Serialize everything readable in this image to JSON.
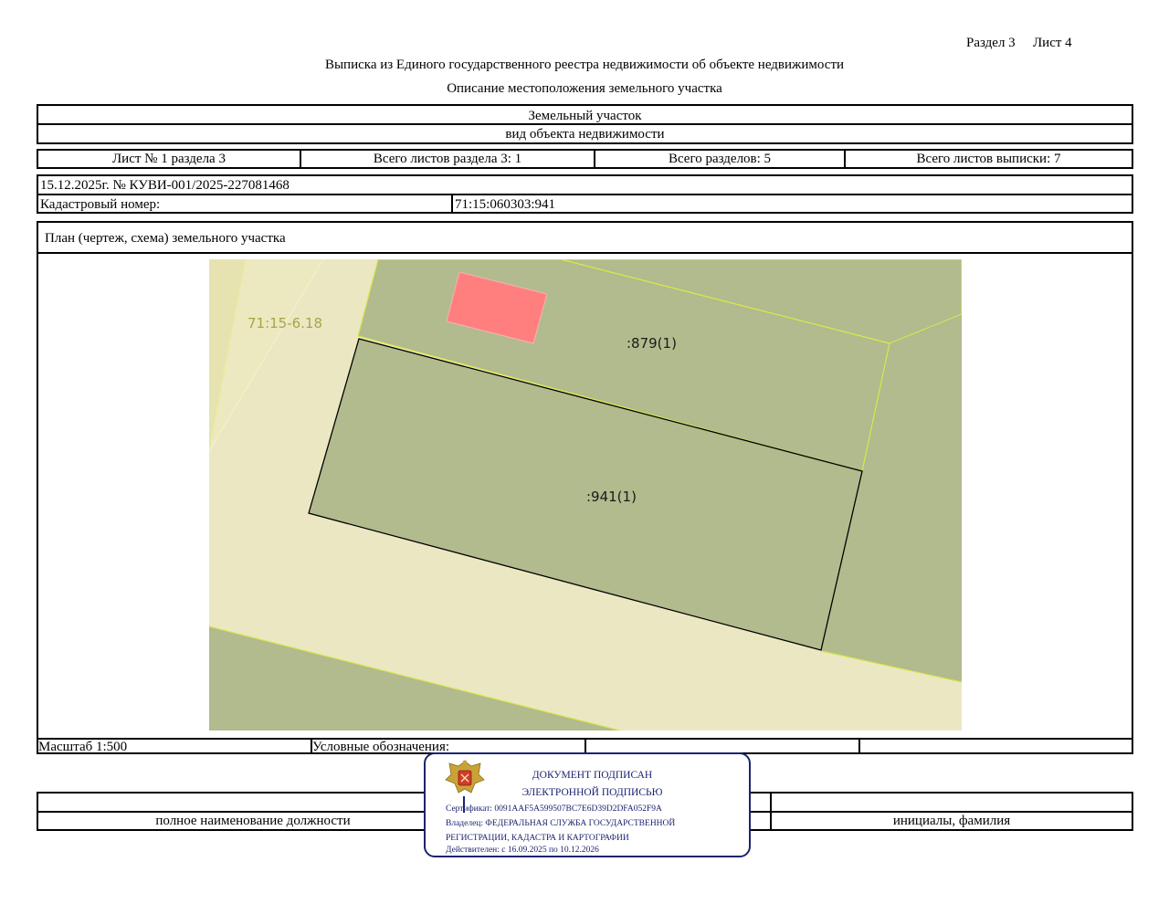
{
  "header": {
    "section_label": "Раздел 3",
    "sheet_label": "Лист 4",
    "title": "Выписка из Единого государственного реестра недвижимости об объекте недвижимости",
    "subtitle": "Описание местоположения земельного участка"
  },
  "object": {
    "type": "Земельный участок",
    "type_caption": "вид объекта недвижимости"
  },
  "sheet_info": {
    "sheet_no": "Лист № 1 раздела 3",
    "total_sheets_section": "Всего листов раздела 3: 1",
    "total_sections": "Всего разделов: 5",
    "total_sheets_extract": "Всего листов выписки: 7"
  },
  "record": {
    "date_number": "15.12.2025г. № КУВИ-001/2025-227081468",
    "cadastral_label": "Кадастровый номер:",
    "cadastral_number": "71:15:060303:941"
  },
  "plan": {
    "title": "План (чертеж, схема) земельного участка",
    "labels": {
      "quarter": "71:15-6.18",
      "parcel_neighbor": ":879(1)",
      "parcel_main": ":941(1)"
    },
    "colors": {
      "background_light": "#ece7c3",
      "parcel_green": "#b1bb8d",
      "building_red": "#ff7f7f",
      "boundary_yellow": "#d9e84a"
    }
  },
  "footer": {
    "scale": "Масштаб 1:500",
    "legend_label": "Условные обозначения:",
    "position_caption": "полное наименование должности",
    "name_caption": "инициалы, фамилия"
  },
  "stamp": {
    "line1": "ДОКУМЕНТ ПОДПИСАН",
    "line2": "ЭЛЕКТРОННОЙ ПОДПИСЬЮ",
    "certificate": "Сертификат: 0091AAF5A599507BC7E6D39D2DFA052F9A",
    "owner1": "Владелец: ФЕДЕРАЛЬНАЯ СЛУЖБА ГОСУДАРСТВЕННОЙ",
    "owner2": "РЕГИСТРАЦИИ, КАДАСТРА И КАРТОГРАФИИ",
    "valid": "Действителен: с 16.09.2025 по 10.12.2026",
    "border_color": "#1b2470"
  }
}
